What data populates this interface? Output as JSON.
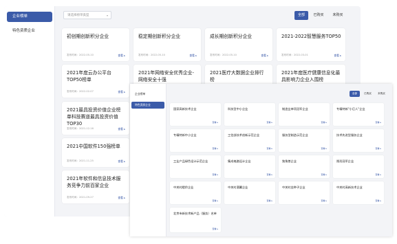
{
  "back_window": {
    "sidebar": [
      {
        "label": "企业榜单",
        "active": true
      },
      {
        "label": "特色资质企业",
        "active": false
      }
    ],
    "select_placeholder": "请选择榜单类型",
    "filters": [
      {
        "label": "全部",
        "active": true
      },
      {
        "label": "已购买",
        "active": false
      },
      {
        "label": "未购买",
        "active": false
      }
    ],
    "date_prefix": "发布时间：",
    "view_label": "查看",
    "cards": [
      {
        "title": "初创期创新积分企业",
        "date": "2022-05-10"
      },
      {
        "title": "稳定期创新积分企业",
        "date": "2022-05-10"
      },
      {
        "title": "成长期创新积分企业",
        "date": "2022-05-10"
      },
      {
        "title": "2021-2022智慧服务TOP50",
        "date": "2022-03-01"
      },
      {
        "title": "2021年度云办公平台TOP50榜单",
        "date": "2022-02-07"
      },
      {
        "title": "2021年网络安全优秀企业-网络安全十强",
        "date": ""
      },
      {
        "title": "2021医疗大数据企业排行榜",
        "date": ""
      },
      {
        "title": "2021年度医疗健康信息化最具影响力企业入围榜",
        "date": ""
      },
      {
        "title": "2021最具投资价值企业榜单科技赛道最具投资价值TOP30",
        "date": "2021-12-16"
      },
      {
        "title": "2021中国软件150强榜单",
        "date": "2021-11-25"
      },
      {
        "title": "2021年软件和信息技术服务竞争力前百家企业",
        "date": "2021-09-27"
      }
    ]
  },
  "front_window": {
    "sidebar": [
      {
        "label": "企业榜单",
        "active": false
      },
      {
        "label": "特色资质企业",
        "active": true
      }
    ],
    "filters": [
      {
        "label": "全部",
        "active": true
      },
      {
        "label": "已购买",
        "active": false
      },
      {
        "label": "未购买",
        "active": false
      }
    ],
    "view_label": "查看",
    "cards": [
      "国家高新技术企业",
      "科技型中小企业",
      "制造业单项冠军企业",
      "专精特新\"小巨人\"企业",
      "专精特新中小企业",
      "工信部技术创新示范企业",
      "服务型制造示范企业",
      "技术先进型服务企业",
      "工业产品绿色设计示范企业",
      "集成电路设计企业",
      "独角兽企业",
      "隐形冠军企业",
      "中关村瞪羚企业",
      "中关村潜翼企业",
      "中关村金种子企业",
      "中关村高新技术企业",
      "北京市新技术新产品（服务）名单"
    ]
  }
}
